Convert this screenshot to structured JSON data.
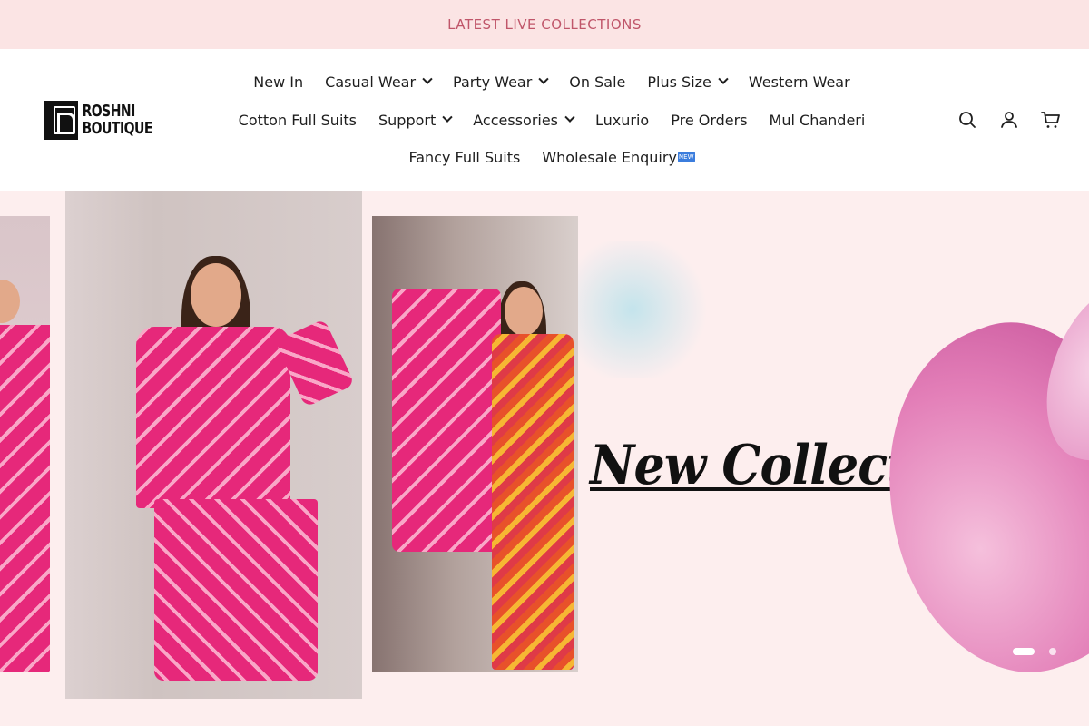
{
  "announcement": {
    "text": "LATEST LIVE COLLECTIONS"
  },
  "brand": {
    "line1": "ROSHNI",
    "line2": "BOUTIQUE"
  },
  "nav": {
    "row1": [
      {
        "label": "New In",
        "dropdown": false
      },
      {
        "label": "Casual Wear",
        "dropdown": true
      },
      {
        "label": "Party Wear",
        "dropdown": true
      },
      {
        "label": "On Sale",
        "dropdown": false
      },
      {
        "label": "Plus Size",
        "dropdown": true
      },
      {
        "label": "Western Wear",
        "dropdown": false
      }
    ],
    "row2": [
      {
        "label": "Cotton Full Suits",
        "dropdown": false
      },
      {
        "label": "Support",
        "dropdown": true
      },
      {
        "label": "Accessories",
        "dropdown": true
      },
      {
        "label": "Luxurio",
        "dropdown": false
      },
      {
        "label": "Pre Orders",
        "dropdown": false
      },
      {
        "label": "Mul Chanderi",
        "dropdown": false
      }
    ],
    "row3": [
      {
        "label": "Fancy Full Suits",
        "dropdown": false
      },
      {
        "label": "Wholesale Enquiry",
        "dropdown": false,
        "badge": "NEW"
      }
    ]
  },
  "header_icons": [
    "search-icon",
    "account-icon",
    "cart-icon"
  ],
  "hero": {
    "headline": "New Collection",
    "slides_total": 2,
    "active_slide": 1
  },
  "colors": {
    "announcement_bg": "#fbe4e4",
    "announcement_text": "#c0566a",
    "hero_bg": "#fdeeee",
    "badge": "#3b7ddd"
  }
}
